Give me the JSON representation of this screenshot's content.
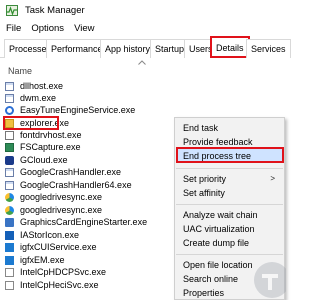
{
  "window": {
    "title": "Task Manager"
  },
  "menu": [
    "File",
    "Options",
    "View"
  ],
  "tabs": [
    "Processes",
    "Performance",
    "App history",
    "Startup",
    "Users",
    "Details",
    "Services"
  ],
  "list": {
    "column_header": "Name"
  },
  "processes": [
    "dllhost.exe",
    "dwm.exe",
    "EasyTuneEngineService.exe",
    "explorer.exe",
    "fontdrvhost.exe",
    "FSCapture.exe",
    "GCloud.exe",
    "GoogleCrashHandler.exe",
    "GoogleCrashHandler64.exe",
    "googledrivesync.exe",
    "googledrivesync.exe",
    "GraphicsCardEngineStarter.exe",
    "IAStorIcon.exe",
    "igfxCUIService.exe",
    "igfxEM.exe",
    "IntelCpHDCPSvc.exe",
    "IntelCpHeciSvc.exe"
  ],
  "context_menu": {
    "items": [
      "End task",
      "Provide feedback",
      "End process tree",
      "Set priority",
      "Set affinity",
      "Analyze wait chain",
      "UAC virtualization",
      "Create dump file",
      "Open file location",
      "Search online",
      "Properties"
    ],
    "submenu_arrow": ">"
  },
  "colors": {
    "highlight_border": "#e0121a",
    "selected_item_bg": "#cfe3ff",
    "menu_bg": "#f2f2f2"
  }
}
